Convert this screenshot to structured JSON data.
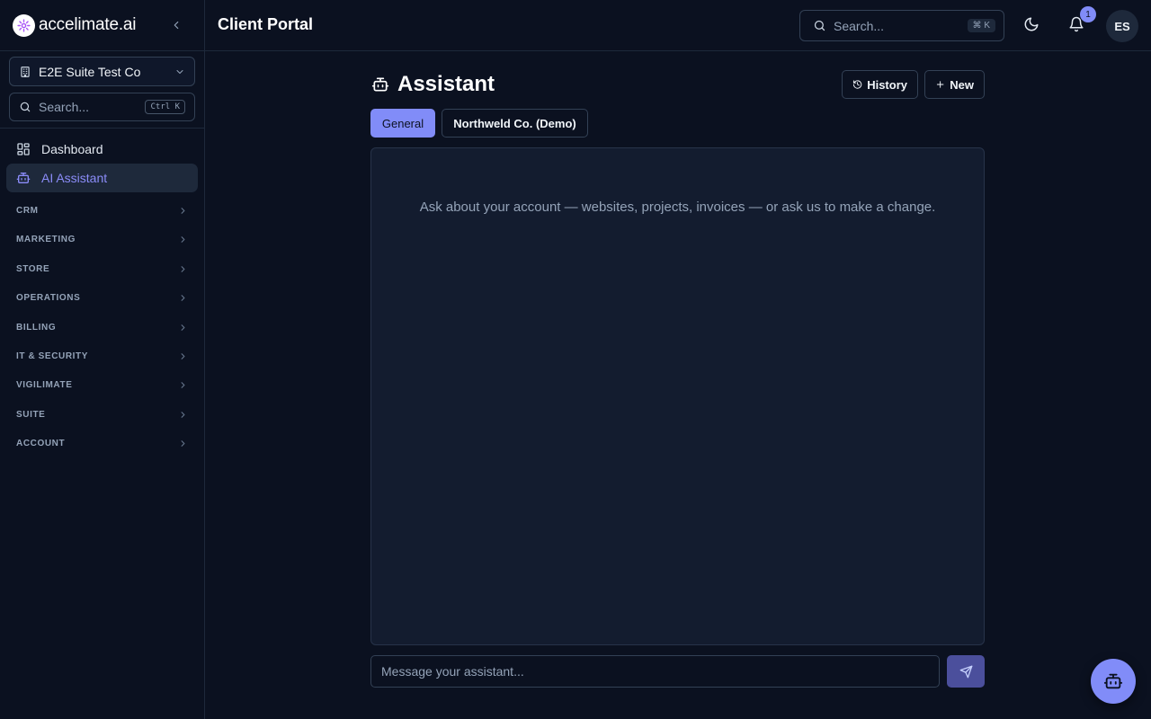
{
  "brand": {
    "name": "accelimate.ai",
    "logo_icon": "brain-icon"
  },
  "header": {
    "title": "Client Portal",
    "search_placeholder": "Search...",
    "search_shortcut": "⌘ K",
    "notification_count": "1",
    "avatar_initials": "ES"
  },
  "sidebar": {
    "company": "E2E Suite Test Co",
    "search_placeholder": "Search...",
    "search_shortcut": "Ctrl K",
    "items": [
      {
        "label": "Dashboard",
        "icon": "grid-icon"
      },
      {
        "label": "AI Assistant",
        "icon": "robot-icon",
        "active": true
      }
    ],
    "sections": [
      "CRM",
      "MARKETING",
      "STORE",
      "OPERATIONS",
      "BILLING",
      "IT & SECURITY",
      "VIGILIMATE",
      "SUITE",
      "ACCOUNT"
    ]
  },
  "main": {
    "title": "Assistant",
    "history_label": "History",
    "new_label": "New",
    "tabs": [
      {
        "label": "General",
        "active": true
      },
      {
        "label": "Northweld Co. (Demo)",
        "active": false
      }
    ],
    "empty_message": "Ask about your account — websites, projects, invoices — or ask us to make a change.",
    "composer_placeholder": "Message your assistant..."
  },
  "colors": {
    "background": "#0b1120",
    "panel": "#131c2f",
    "accent": "#818cf8",
    "border": "#334155"
  }
}
